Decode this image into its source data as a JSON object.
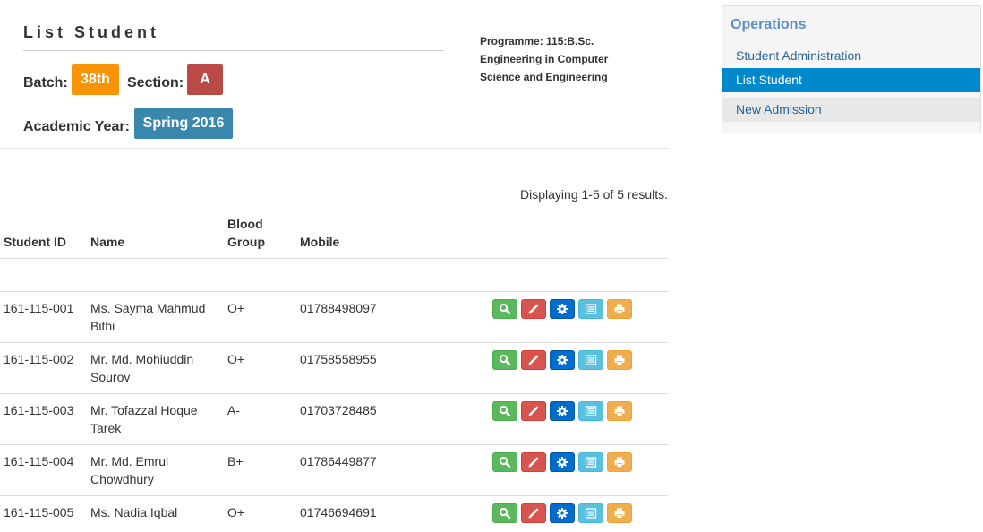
{
  "page": {
    "title": "List Student",
    "batch_label": "Batch:",
    "batch_value": "38th",
    "section_label": "Section:",
    "section_value": "A",
    "year_label": "Academic Year:",
    "year_value": "Spring 2016",
    "programme_lines": [
      "Programme: 115:B.Sc.",
      "Engineering in Computer",
      "Science and Engineering"
    ]
  },
  "colors": {
    "batch_badge": "#f89406",
    "section_badge": "#b94a48",
    "year_badge": "#3a87ad",
    "sidebar_active": "#0088cc"
  },
  "table": {
    "summary": "Displaying 1-5 of 5 results.",
    "headers": {
      "student_id": "Student ID",
      "name": "Name",
      "blood_line1": "Blood",
      "blood_line2": "Group",
      "mobile": "Mobile"
    },
    "action_icons": [
      "search-icon",
      "pencil-icon",
      "cog-icon",
      "list-icon",
      "print-icon"
    ],
    "rows": [
      {
        "id": "161-115-001",
        "name_line1": "Ms. Sayma Mahmud",
        "name_line2": "Bithi",
        "blood": "O+",
        "mobile": "01788498097"
      },
      {
        "id": "161-115-002",
        "name_line1": "Mr. Md. Mohiuddin",
        "name_line2": "Sourov",
        "blood": "O+",
        "mobile": "01758558955"
      },
      {
        "id": "161-115-003",
        "name_line1": "Mr. Tofazzal Hoque",
        "name_line2": "Tarek",
        "blood": "A-",
        "mobile": "01703728485"
      },
      {
        "id": "161-115-004",
        "name_line1": "Mr. Md. Emrul",
        "name_line2": "Chowdhury",
        "blood": "B+",
        "mobile": "01786449877"
      },
      {
        "id": "161-115-005",
        "name_line1": "Ms. Nadia Iqbal",
        "name_line2": "",
        "blood": "O+",
        "mobile": "01746694691"
      }
    ]
  },
  "sidebar": {
    "title": "Operations",
    "items": [
      {
        "label": "Student Administration",
        "state": "normal"
      },
      {
        "label": "List Student",
        "state": "active"
      },
      {
        "label": "New Admission",
        "state": "normal"
      }
    ]
  }
}
